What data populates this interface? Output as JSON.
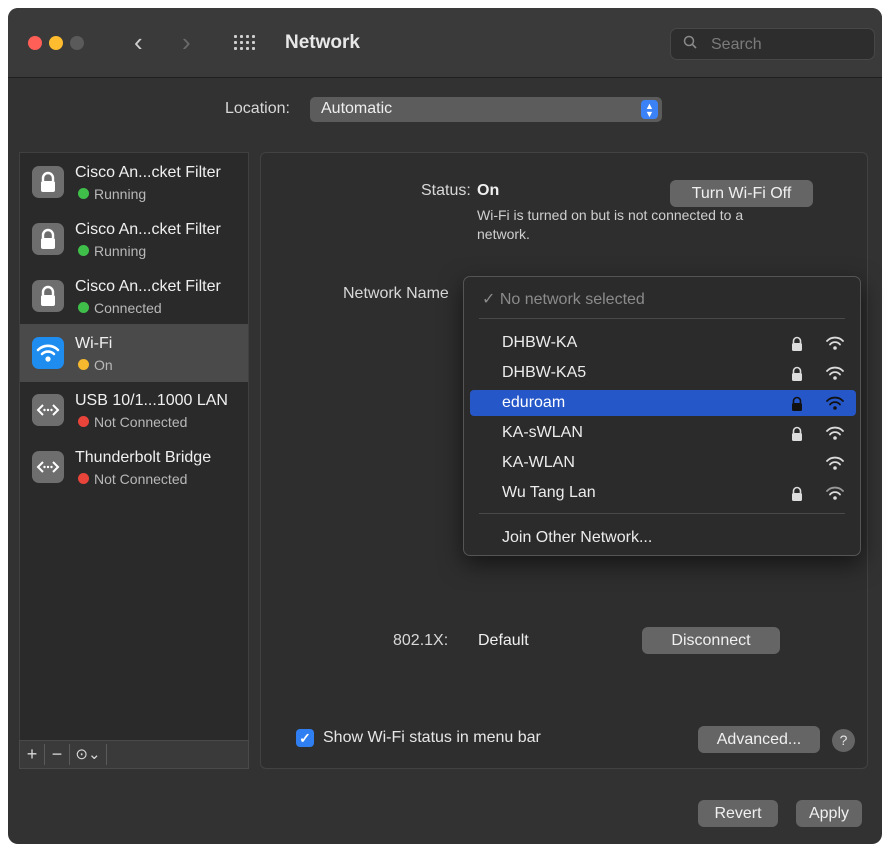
{
  "window": {
    "title": "Network",
    "search_placeholder": "Search"
  },
  "location": {
    "label": "Location:",
    "value": "Automatic"
  },
  "sidebar": {
    "services": [
      {
        "name": "Cisco An...cket Filter",
        "status": "Running",
        "status_color": "#3fbf4a",
        "icon": "lock-icon"
      },
      {
        "name": "Cisco An...cket Filter",
        "status": "Running",
        "status_color": "#3fbf4a",
        "icon": "lock-icon"
      },
      {
        "name": "Cisco An...cket Filter",
        "status": "Connected",
        "status_color": "#3fbf4a",
        "icon": "lock-icon"
      },
      {
        "name": "Wi-Fi",
        "status": "On",
        "status_color": "#f5b82e",
        "icon": "wifi-icon"
      },
      {
        "name": "USB 10/1...1000 LAN",
        "status": "Not Connected",
        "status_color": "#e8443a",
        "icon": "ethernet-icon"
      },
      {
        "name": "Thunderbolt Bridge",
        "status": "Not Connected",
        "status_color": "#e8443a",
        "icon": "ethernet-icon"
      }
    ],
    "bottom": {
      "add": "+",
      "remove": "−",
      "action": "⊙⌄"
    }
  },
  "main": {
    "status_label": "Status:",
    "status_value": "On",
    "status_description": "Wi-Fi is turned on but is not connected to a network.",
    "turn_off_button": "Turn Wi-Fi Off",
    "network_name_label": "Network Name",
    "dot1x_label": "802.1X:",
    "dot1x_value": "Default",
    "disconnect_button": "Disconnect",
    "show_status_label": "Show Wi-Fi status in menu bar",
    "show_status_checked": true,
    "advanced_button": "Advanced...",
    "help": "?"
  },
  "dropdown": {
    "none_item": "✓ No network selected",
    "networks": [
      {
        "name": "DHBW-KA",
        "locked": true,
        "selected": false
      },
      {
        "name": "DHBW-KA5",
        "locked": true,
        "selected": false
      },
      {
        "name": "eduroam",
        "locked": true,
        "selected": true
      },
      {
        "name": "KA-sWLAN",
        "locked": true,
        "selected": false
      },
      {
        "name": "KA-WLAN",
        "locked": false,
        "selected": false
      },
      {
        "name": "Wu Tang Lan",
        "locked": true,
        "selected": false
      }
    ],
    "join_other": "Join Other Network..."
  },
  "footer": {
    "revert_button": "Revert",
    "apply_button": "Apply"
  }
}
